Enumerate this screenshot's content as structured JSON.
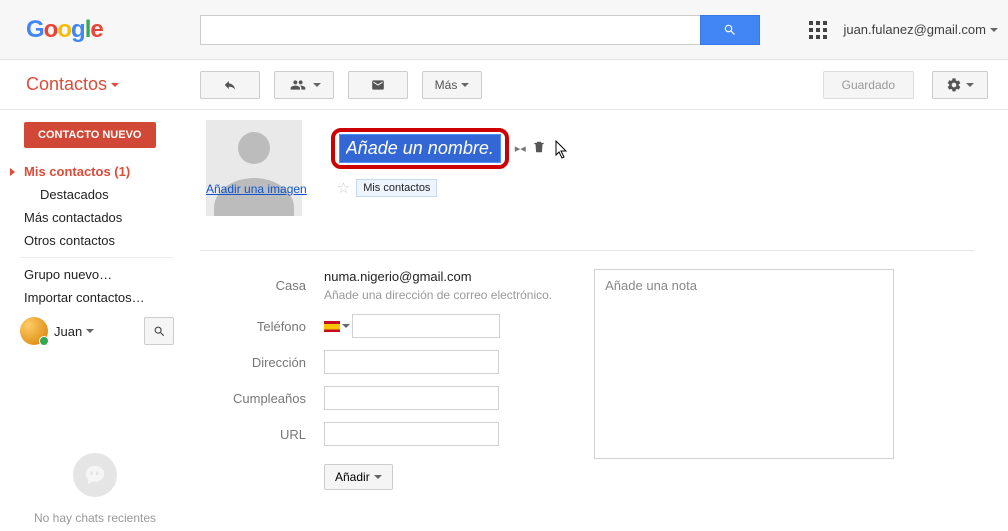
{
  "header": {
    "logo_chars": [
      "G",
      "o",
      "o",
      "g",
      "l",
      "e"
    ],
    "user_email": "juan.fulanez@gmail.com"
  },
  "toolbar": {
    "app_title": "Contactos",
    "more_label": "Más",
    "saved_label": "Guardado"
  },
  "sidebar": {
    "new_contact": "CONTACTO NUEVO",
    "my_contacts": "Mis contactos (1)",
    "starred": "Destacados",
    "most_contacted": "Más contactados",
    "other_contacts": "Otros contactos",
    "new_group": "Grupo nuevo…",
    "import": "Importar contactos…",
    "user_name": "Juan",
    "no_chats": "No hay chats recientes"
  },
  "contact": {
    "add_image": "Añadir una imagen",
    "name_placeholder": "Añade un nombre.",
    "tag": "Mis contactos",
    "fields": {
      "home_label": "Casa",
      "email_value": "numa.nigerio@gmail.com",
      "email_hint": "Añade una dirección de correo electrónico.",
      "phone_label": "Teléfono",
      "address_label": "Dirección",
      "birthday_label": "Cumpleaños",
      "url_label": "URL"
    },
    "add_btn": "Añadir",
    "note_placeholder": "Añade una nota"
  }
}
